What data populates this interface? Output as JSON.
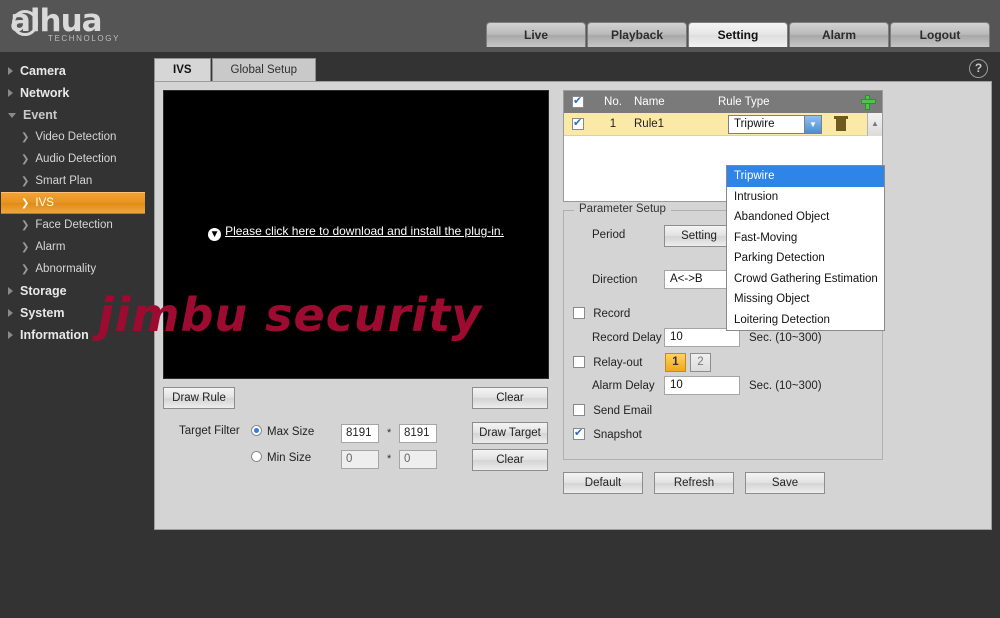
{
  "brand": {
    "name": "alhua",
    "tagline": "TECHNOLOGY"
  },
  "topnav": {
    "items": [
      {
        "label": "Live",
        "active": false
      },
      {
        "label": "Playback",
        "active": false
      },
      {
        "label": "Setting",
        "active": true
      },
      {
        "label": "Alarm",
        "active": false
      },
      {
        "label": "Logout",
        "active": false
      }
    ]
  },
  "sidebar": {
    "items": [
      {
        "label": "Camera",
        "level": "top",
        "state": "collapsed"
      },
      {
        "label": "Network",
        "level": "top",
        "state": "collapsed"
      },
      {
        "label": "Event",
        "level": "top",
        "state": "expanded"
      },
      {
        "label": "Video Detection",
        "level": "sub",
        "active": false
      },
      {
        "label": "Audio Detection",
        "level": "sub",
        "active": false
      },
      {
        "label": "Smart Plan",
        "level": "sub",
        "active": false
      },
      {
        "label": "IVS",
        "level": "sub",
        "active": true
      },
      {
        "label": "Face Detection",
        "level": "sub",
        "active": false
      },
      {
        "label": "Alarm",
        "level": "sub",
        "active": false
      },
      {
        "label": "Abnormality",
        "level": "sub",
        "active": false
      },
      {
        "label": "Storage",
        "level": "top",
        "state": "collapsed"
      },
      {
        "label": "System",
        "level": "top",
        "state": "collapsed"
      },
      {
        "label": "Information",
        "level": "top",
        "state": "collapsed"
      }
    ]
  },
  "subtabs": {
    "items": [
      {
        "label": "IVS",
        "active": true
      },
      {
        "label": "Global Setup",
        "active": false
      }
    ]
  },
  "help": {
    "glyph": "?"
  },
  "video": {
    "plugin_message": "Please click here to download and install the plug-in.",
    "download_glyph": "▼"
  },
  "draw": {
    "draw_rule_label": "Draw Rule",
    "clear_top_label": "Clear",
    "draw_target_label": "Draw Target",
    "clear_bottom_label": "Clear"
  },
  "target_filter": {
    "label": "Target Filter",
    "max": {
      "label": "Max Size",
      "selected": true,
      "width": "8191",
      "height": "8191",
      "separator": "*"
    },
    "min": {
      "label": "Min Size",
      "selected": false,
      "width": "0",
      "height": "0",
      "separator": "*"
    }
  },
  "rule_table": {
    "headers": {
      "no": "No.",
      "name": "Name",
      "type": "Rule Type"
    },
    "header_checkbox_checked": true,
    "add_icon": "plus-icon",
    "rows": [
      {
        "checked": true,
        "no": "1",
        "name": "Rule1",
        "type": "Tripwire"
      }
    ],
    "scroll_up_glyph": "▲"
  },
  "rule_type_dropdown": {
    "open": true,
    "selected": "Tripwire",
    "options": [
      "Tripwire",
      "Intrusion",
      "Abandoned Object",
      "Fast-Moving",
      "Parking Detection",
      "Crowd Gathering Estimation",
      "Missing Object",
      "Loitering Detection"
    ]
  },
  "parameter_setup": {
    "legend": "Parameter Setup",
    "period": {
      "label": "Period",
      "button_label": "Setting"
    },
    "direction": {
      "label": "Direction",
      "value": "A<->B"
    },
    "record": {
      "label": "Record",
      "checked": false
    },
    "record_delay": {
      "label": "Record Delay",
      "value": "10",
      "unit": "Sec. (10~300)"
    },
    "relay_out": {
      "label": "Relay-out",
      "checked": false,
      "ports": [
        {
          "label": "1",
          "active": true
        },
        {
          "label": "2",
          "active": false
        }
      ]
    },
    "alarm_delay": {
      "label": "Alarm Delay",
      "value": "10",
      "unit": "Sec. (10~300)"
    },
    "send_email": {
      "label": "Send Email",
      "checked": false
    },
    "snapshot": {
      "label": "Snapshot",
      "checked": true
    }
  },
  "actions": {
    "default_label": "Default",
    "refresh_label": "Refresh",
    "save_label": "Save"
  },
  "watermark": {
    "text": "jimbu security",
    "color": "#9e0b30"
  },
  "colors": {
    "accent_orange": "#e8941f",
    "header_gray": "#555555",
    "panel_gray": "#d4d4d4",
    "row_highlight": "#fbe9a7",
    "dropdown_select_blue": "#2f84e8",
    "background_dark": "#333333"
  }
}
